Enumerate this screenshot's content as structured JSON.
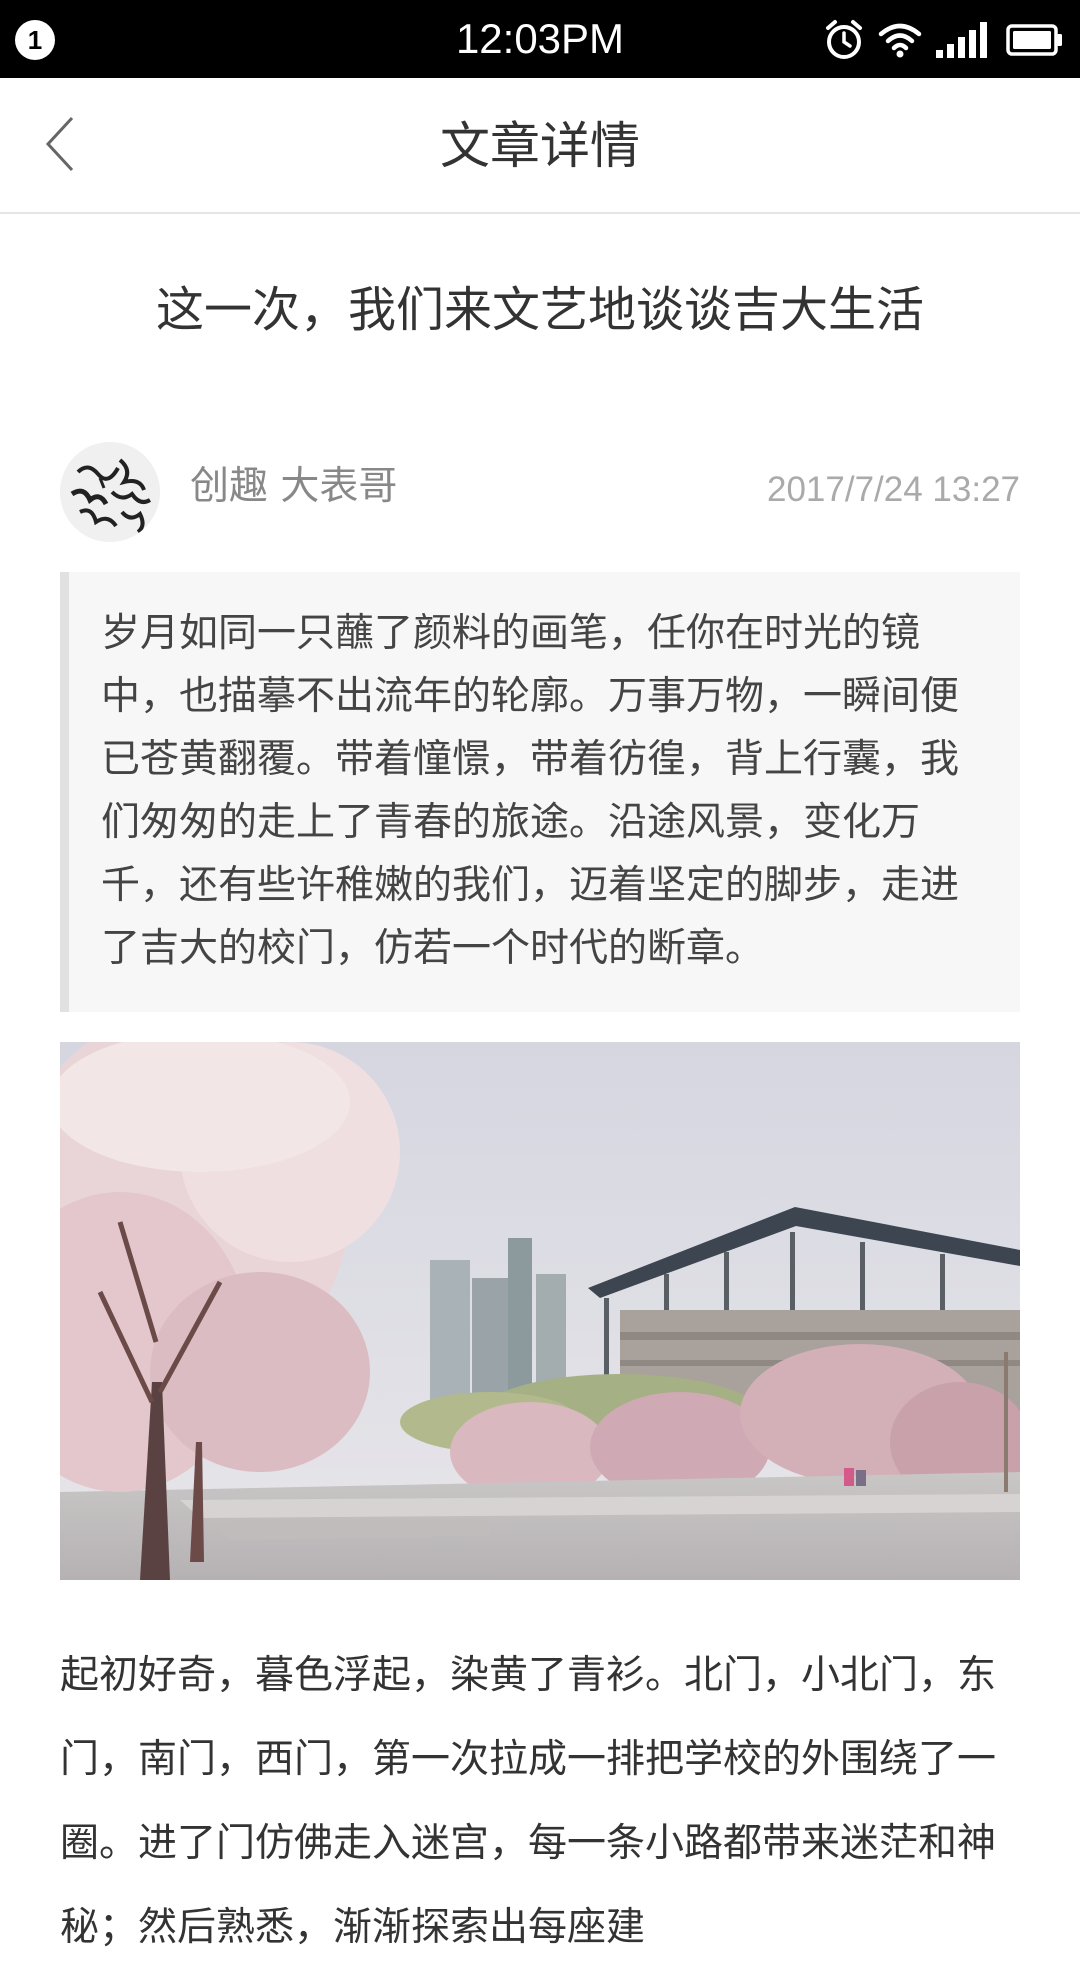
{
  "status_bar": {
    "notification_count": "1",
    "time": "12:03PM",
    "icons": [
      "alarm-icon",
      "wifi-icon",
      "signal-icon",
      "battery-icon"
    ]
  },
  "header": {
    "back_icon": "chevron-left-icon",
    "title": "文章详情"
  },
  "article": {
    "title": "这一次，我们来文艺地谈谈吉大生活",
    "author": "创趣 大表哥",
    "publish_time": "2017/7/24 13:27",
    "quote": "岁月如同一只蘸了颜料的画笔，任你在时光的镜中，也描摹不出流年的轮廓。万事万物，一瞬间便已苍黄翻覆。带着憧憬，带着彷徨，背上行囊，我们匆匆的走上了青春的旅途。沿途风景，变化万千，还有些许稚嫩的我们，迈着坚定的脚步，走进了吉大的校门，仿若一个时代的断章。",
    "body": "起初好奇，暮色浮起，染黄了青衫。北门，小北门，东门，南门，西门，第一次拉成一排把学校的外围绕了一圈。进了门仿佛走入迷宫，每一条小路都带来迷茫和神秘；然后熟悉，渐渐探索出每座建"
  },
  "colors": {
    "status_bar_bg": "#000000",
    "header_divider": "#e6e6e6",
    "quote_bg": "#f7f7f7",
    "quote_border": "#e1e1e1",
    "meta_text": "#888888"
  }
}
